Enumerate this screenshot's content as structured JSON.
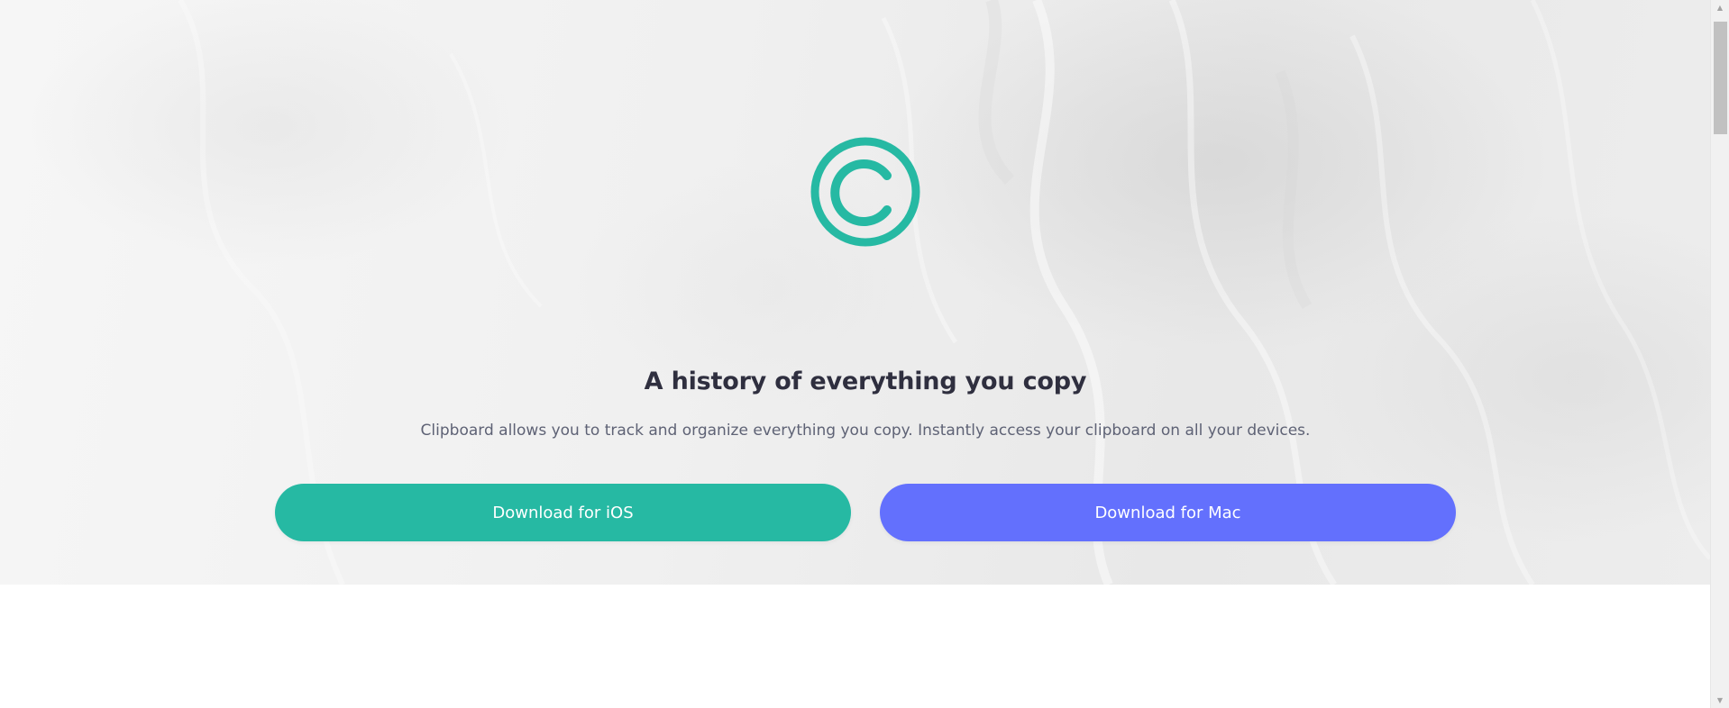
{
  "hero": {
    "logo_icon": "clipboard-c-logo-icon",
    "headline": "A history of everything you copy",
    "description": "Clipboard allows you to track and organize everything you copy. Instantly access your clipboard on all your devices."
  },
  "buttons": {
    "ios_label": "Download for iOS",
    "mac_label": "Download for Mac"
  },
  "colors": {
    "primary_teal": "#26b9a3",
    "primary_blue": "#6370fd",
    "heading": "#2f2f3f",
    "body_text": "#5e6275"
  },
  "scrollbar": {
    "up_icon": "scroll-up-arrow-icon",
    "down_icon": "scroll-down-arrow-icon"
  }
}
